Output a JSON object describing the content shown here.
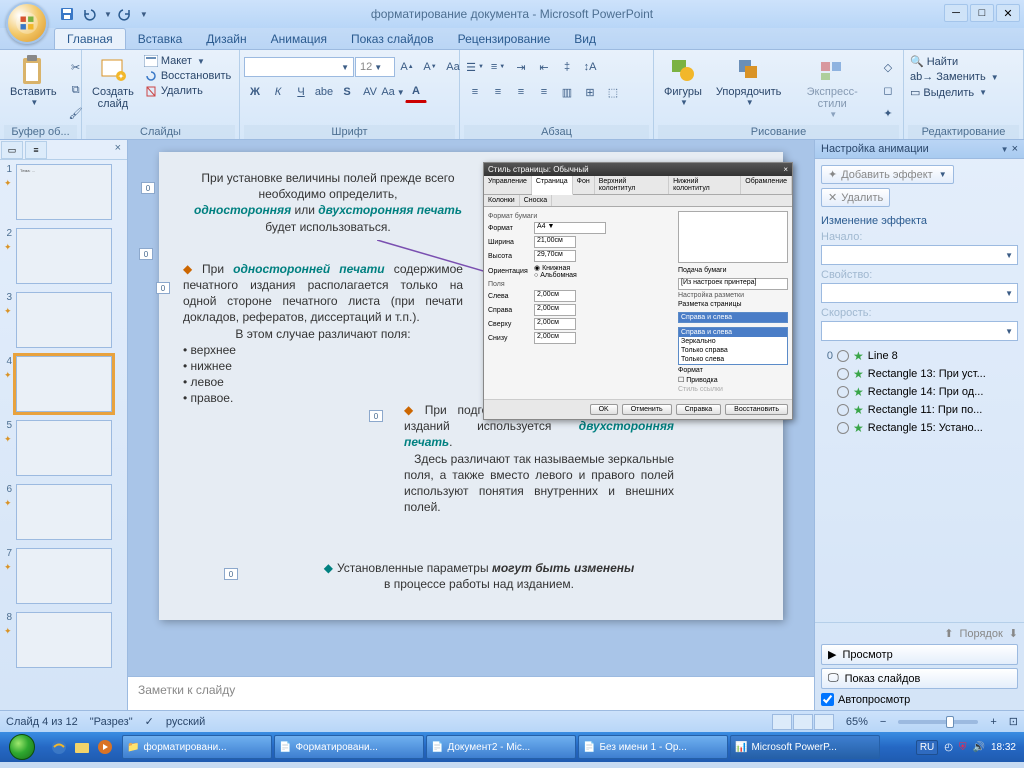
{
  "app": {
    "title": "форматирование документа - Microsoft PowerPoint"
  },
  "tabs": [
    "Главная",
    "Вставка",
    "Дизайн",
    "Анимация",
    "Показ слайдов",
    "Рецензирование",
    "Вид"
  ],
  "ribbon": {
    "clipboard": {
      "label": "Буфер об...",
      "paste": "Вставить"
    },
    "slides": {
      "label": "Слайды",
      "new": "Создать\nслайд",
      "layout": "Макет",
      "reset": "Восстановить",
      "delete": "Удалить"
    },
    "font": {
      "label": "Шрифт",
      "size": "12"
    },
    "paragraph": {
      "label": "Абзац"
    },
    "drawing": {
      "label": "Рисование",
      "shapes": "Фигуры",
      "arrange": "Упорядочить",
      "styles": "Экспресс-стили"
    },
    "editing": {
      "label": "Редактирование",
      "find": "Найти",
      "replace": "Заменить",
      "select": "Выделить"
    }
  },
  "slide": {
    "p1a": "При установке величины полей прежде всего необходимо определить,",
    "p1b": "односторонняя",
    "p1c": "или ",
    "p1d": "двухсторонняя печать",
    "p1e": "будет использоваться.",
    "p2": "При односторонней печати содержимое печатного издания располагается только на одной стороне печатного листа (при печати докладов, рефератов, диссертаций и т.п.).",
    "p2b": "В этом случае различают поля:",
    "bul1": "верхнее",
    "bul2": "нижнее",
    "bul3": "левое",
    "bul4": "правое.",
    "p3a": "При подготовке журнальных и книжных изданий используется",
    "p3b": "двухсторонняя печать",
    "p3c": "Здесь различают так называемые зеркальные поля, а также вместо левого и правого полей используют понятия внутренних и внешних полей.",
    "p4a": "Установленные параметры ",
    "p4b": "могут быть изменены",
    "p4c": "в процессе работы над изданием."
  },
  "dialog": {
    "title": "Стиль страницы: Обычный",
    "tabs": [
      "Управление",
      "Страница",
      "Фон",
      "Верхний колонтитул",
      "Нижний колонтитул",
      "Обрамление",
      "Колонки",
      "Сноска"
    ],
    "section1": "Формат бумаги",
    "format": "Формат",
    "format_v": "A4",
    "width": "Ширина",
    "width_v": "21,00см",
    "height": "Высота",
    "height_v": "29,70см",
    "orient": "Ориентация",
    "orient1": "Книжная",
    "orient2": "Альбомная",
    "section2": "Поля",
    "left": "Слева",
    "left_v": "2,00см",
    "right": "Справа",
    "right_v": "2,00см",
    "top": "Сверху",
    "top_v": "2,00см",
    "bottom": "Снизу",
    "bottom_v": "2,00см",
    "paperfeed": "Подача бумаги",
    "paperfeed_v": "[Из настроек принтера]",
    "section3": "Настройка разметки",
    "pagelayout": "Разметка страницы",
    "dd": [
      "Справа и слева",
      "Справа и слева",
      "Зеркально",
      "Только справа",
      "Только слева"
    ],
    "format2": "Формат",
    "register": "Приводка",
    "regstyle": "Стиль ссылки",
    "ok": "OK",
    "cancel": "Отменить",
    "help": "Справка",
    "restore": "Восстановить"
  },
  "notes": "Заметки к слайду",
  "animpane": {
    "title": "Настройка анимации",
    "add": "Добавить эффект",
    "remove": "Удалить",
    "changehdr": "Изменение эффекта",
    "start": "Начало:",
    "prop": "Свойство:",
    "speed": "Скорость:",
    "items": [
      {
        "n": "0",
        "t": "Line 8"
      },
      {
        "n": "",
        "t": "Rectangle 13: При уст..."
      },
      {
        "n": "",
        "t": "Rectangle 14:  При од..."
      },
      {
        "n": "",
        "t": "Rectangle 11: При по..."
      },
      {
        "n": "",
        "t": "Rectangle 15:  Устано..."
      }
    ],
    "order": "Порядок",
    "preview": "Просмотр",
    "slideshow": "Показ слайдов",
    "auto": "Автопросмотр"
  },
  "status": {
    "slide": "Слайд 4 из 12",
    "theme": "\"Разрез\"",
    "lang": "русский",
    "zoom": "65%"
  },
  "taskbar": {
    "items": [
      "форматировани...",
      "Форматировани...",
      "Документ2 - Mic...",
      "Без имени 1 - Op...",
      "Microsoft PowerP..."
    ],
    "lang": "RU",
    "time": "18:32"
  },
  "dlg_close": "×"
}
